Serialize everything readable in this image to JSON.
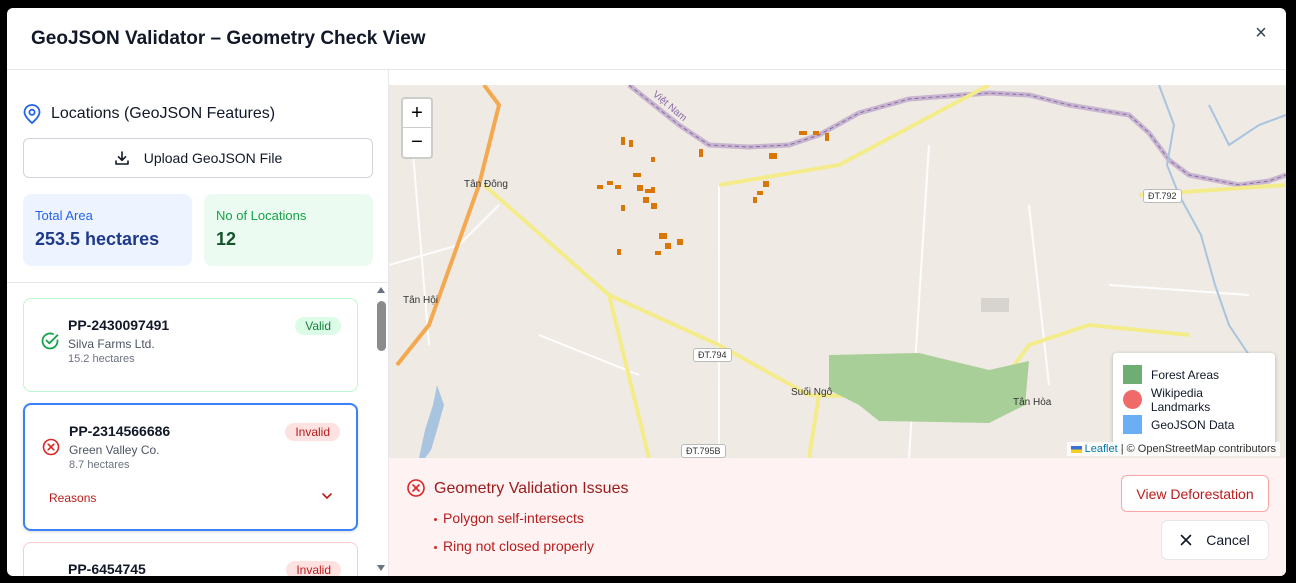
{
  "header": {
    "title": "GeoJSON Validator – Geometry Check View",
    "close_glyph": "×"
  },
  "sidebar": {
    "heading": "Locations (GeoJSON Features)",
    "upload_label": "Upload GeoJSON File",
    "stats": {
      "total_area_label": "Total Area",
      "total_area_value": "253.5 hectares",
      "count_label": "No of Locations",
      "count_value": "12"
    },
    "locations": [
      {
        "id": "PP-2430097491",
        "owner": "Silva Farms Ltd.",
        "area": "15.2 hectares",
        "status": "Valid"
      },
      {
        "id": "PP-2314566686",
        "owner": "Green Valley Co.",
        "area": "8.7 hectares",
        "status": "Invalid",
        "reasons_label": "Reasons"
      },
      {
        "id": "PP-6454745",
        "status": "Invalid"
      }
    ]
  },
  "map": {
    "zoom_in": "+",
    "zoom_out": "−",
    "place_labels": {
      "tan_dong": "Tân Đông",
      "tan_hoi": "Tân Hội",
      "suoi_ngo": "Suối Ngô",
      "tan_hoa": "Tân Hòa",
      "viet_nam": "Việt Nam"
    },
    "road_tags": {
      "dt792": "ĐT.792",
      "dt794": "ĐT.794",
      "dt795b": "ĐT.795B"
    },
    "legend": [
      {
        "label": "Forest Areas",
        "color": "#6fae72"
      },
      {
        "label": "Wikipedia Landmarks",
        "color": "#f06a6a"
      },
      {
        "label": "GeoJSON Data",
        "color": "#6aaef5"
      }
    ],
    "attribution_leaflet": "Leaflet",
    "attribution_rest": " | © OpenStreetMap contributors"
  },
  "issues": {
    "title": "Geometry Validation Issues",
    "items": [
      "Polygon self-intersects",
      "Ring not closed properly"
    ],
    "view_deforestation_label": "View Deforestation",
    "cancel_label": "Cancel"
  },
  "colors": {
    "valid": "#16a34a",
    "invalid": "#dc2626",
    "accent": "#3b82f6"
  }
}
